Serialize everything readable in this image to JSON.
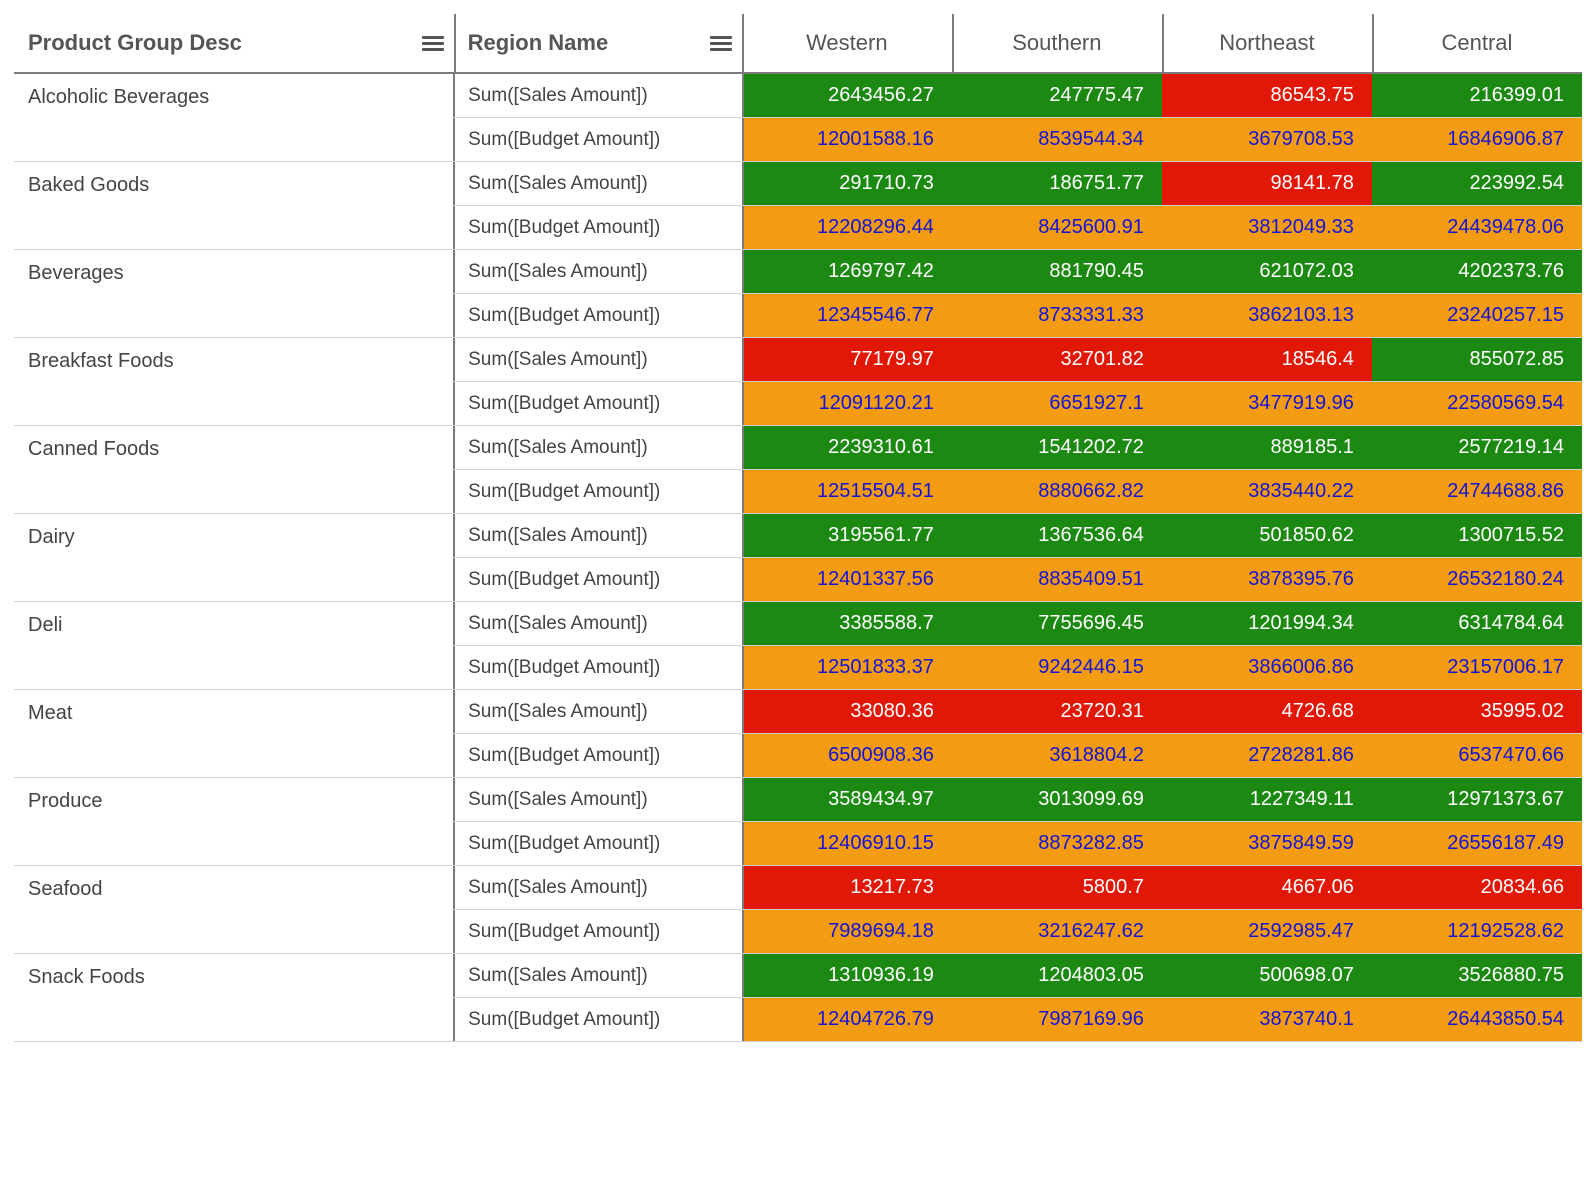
{
  "colors": {
    "green": "#1c8a12",
    "red": "#e11807",
    "orange": "#f39c12",
    "blueText": "#1414d6"
  },
  "headers": {
    "productGroup": "Product Group Desc",
    "regionName": "Region Name",
    "regions": [
      "Western",
      "Southern",
      "Northeast",
      "Central"
    ]
  },
  "metricLabels": {
    "sales": "Sum([Sales Amount])",
    "budget": "Sum([Budget Amount])"
  },
  "rows": [
    {
      "group": "Alcoholic Beverages",
      "sales": [
        {
          "v": "2643456.27",
          "c": "green"
        },
        {
          "v": "247775.47",
          "c": "green"
        },
        {
          "v": "86543.75",
          "c": "red"
        },
        {
          "v": "216399.01",
          "c": "green"
        }
      ],
      "budget": [
        {
          "v": "12001588.16",
          "c": "orange"
        },
        {
          "v": "8539544.34",
          "c": "orange"
        },
        {
          "v": "3679708.53",
          "c": "orange"
        },
        {
          "v": "16846906.87",
          "c": "orange"
        }
      ]
    },
    {
      "group": "Baked Goods",
      "sales": [
        {
          "v": "291710.73",
          "c": "green"
        },
        {
          "v": "186751.77",
          "c": "green"
        },
        {
          "v": "98141.78",
          "c": "red"
        },
        {
          "v": "223992.54",
          "c": "green"
        }
      ],
      "budget": [
        {
          "v": "12208296.44",
          "c": "orange"
        },
        {
          "v": "8425600.91",
          "c": "orange"
        },
        {
          "v": "3812049.33",
          "c": "orange"
        },
        {
          "v": "24439478.06",
          "c": "orange"
        }
      ]
    },
    {
      "group": "Beverages",
      "sales": [
        {
          "v": "1269797.42",
          "c": "green"
        },
        {
          "v": "881790.45",
          "c": "green"
        },
        {
          "v": "621072.03",
          "c": "green"
        },
        {
          "v": "4202373.76",
          "c": "green"
        }
      ],
      "budget": [
        {
          "v": "12345546.77",
          "c": "orange"
        },
        {
          "v": "8733331.33",
          "c": "orange"
        },
        {
          "v": "3862103.13",
          "c": "orange"
        },
        {
          "v": "23240257.15",
          "c": "orange"
        }
      ]
    },
    {
      "group": "Breakfast Foods",
      "sales": [
        {
          "v": "77179.97",
          "c": "red"
        },
        {
          "v": "32701.82",
          "c": "red"
        },
        {
          "v": "18546.4",
          "c": "red"
        },
        {
          "v": "855072.85",
          "c": "green"
        }
      ],
      "budget": [
        {
          "v": "12091120.21",
          "c": "orange"
        },
        {
          "v": "6651927.1",
          "c": "orange"
        },
        {
          "v": "3477919.96",
          "c": "orange"
        },
        {
          "v": "22580569.54",
          "c": "orange"
        }
      ]
    },
    {
      "group": "Canned Foods",
      "sales": [
        {
          "v": "2239310.61",
          "c": "green"
        },
        {
          "v": "1541202.72",
          "c": "green"
        },
        {
          "v": "889185.1",
          "c": "green"
        },
        {
          "v": "2577219.14",
          "c": "green"
        }
      ],
      "budget": [
        {
          "v": "12515504.51",
          "c": "orange"
        },
        {
          "v": "8880662.82",
          "c": "orange"
        },
        {
          "v": "3835440.22",
          "c": "orange"
        },
        {
          "v": "24744688.86",
          "c": "orange"
        }
      ]
    },
    {
      "group": "Dairy",
      "sales": [
        {
          "v": "3195561.77",
          "c": "green"
        },
        {
          "v": "1367536.64",
          "c": "green"
        },
        {
          "v": "501850.62",
          "c": "green"
        },
        {
          "v": "1300715.52",
          "c": "green"
        }
      ],
      "budget": [
        {
          "v": "12401337.56",
          "c": "orange"
        },
        {
          "v": "8835409.51",
          "c": "orange"
        },
        {
          "v": "3878395.76",
          "c": "orange"
        },
        {
          "v": "26532180.24",
          "c": "orange"
        }
      ]
    },
    {
      "group": "Deli",
      "sales": [
        {
          "v": "3385588.7",
          "c": "green"
        },
        {
          "v": "7755696.45",
          "c": "green"
        },
        {
          "v": "1201994.34",
          "c": "green"
        },
        {
          "v": "6314784.64",
          "c": "green"
        }
      ],
      "budget": [
        {
          "v": "12501833.37",
          "c": "orange"
        },
        {
          "v": "9242446.15",
          "c": "orange"
        },
        {
          "v": "3866006.86",
          "c": "orange"
        },
        {
          "v": "23157006.17",
          "c": "orange"
        }
      ]
    },
    {
      "group": "Meat",
      "sales": [
        {
          "v": "33080.36",
          "c": "red"
        },
        {
          "v": "23720.31",
          "c": "red"
        },
        {
          "v": "4726.68",
          "c": "red"
        },
        {
          "v": "35995.02",
          "c": "red"
        }
      ],
      "budget": [
        {
          "v": "6500908.36",
          "c": "orange"
        },
        {
          "v": "3618804.2",
          "c": "orange"
        },
        {
          "v": "2728281.86",
          "c": "orange"
        },
        {
          "v": "6537470.66",
          "c": "orange"
        }
      ]
    },
    {
      "group": "Produce",
      "sales": [
        {
          "v": "3589434.97",
          "c": "green"
        },
        {
          "v": "3013099.69",
          "c": "green"
        },
        {
          "v": "1227349.11",
          "c": "green"
        },
        {
          "v": "12971373.67",
          "c": "green"
        }
      ],
      "budget": [
        {
          "v": "12406910.15",
          "c": "orange"
        },
        {
          "v": "8873282.85",
          "c": "orange"
        },
        {
          "v": "3875849.59",
          "c": "orange"
        },
        {
          "v": "26556187.49",
          "c": "orange"
        }
      ]
    },
    {
      "group": "Seafood",
      "sales": [
        {
          "v": "13217.73",
          "c": "red"
        },
        {
          "v": "5800.7",
          "c": "red"
        },
        {
          "v": "4667.06",
          "c": "red"
        },
        {
          "v": "20834.66",
          "c": "red"
        }
      ],
      "budget": [
        {
          "v": "7989694.18",
          "c": "orange"
        },
        {
          "v": "3216247.62",
          "c": "orange"
        },
        {
          "v": "2592985.47",
          "c": "orange"
        },
        {
          "v": "12192528.62",
          "c": "orange"
        }
      ]
    },
    {
      "group": "Snack Foods",
      "sales": [
        {
          "v": "1310936.19",
          "c": "green"
        },
        {
          "v": "1204803.05",
          "c": "green"
        },
        {
          "v": "500698.07",
          "c": "green"
        },
        {
          "v": "3526880.75",
          "c": "green"
        }
      ],
      "budget": [
        {
          "v": "12404726.79",
          "c": "orange"
        },
        {
          "v": "7987169.96",
          "c": "orange"
        },
        {
          "v": "3873740.1",
          "c": "orange"
        },
        {
          "v": "26443850.54",
          "c": "orange"
        }
      ]
    }
  ]
}
